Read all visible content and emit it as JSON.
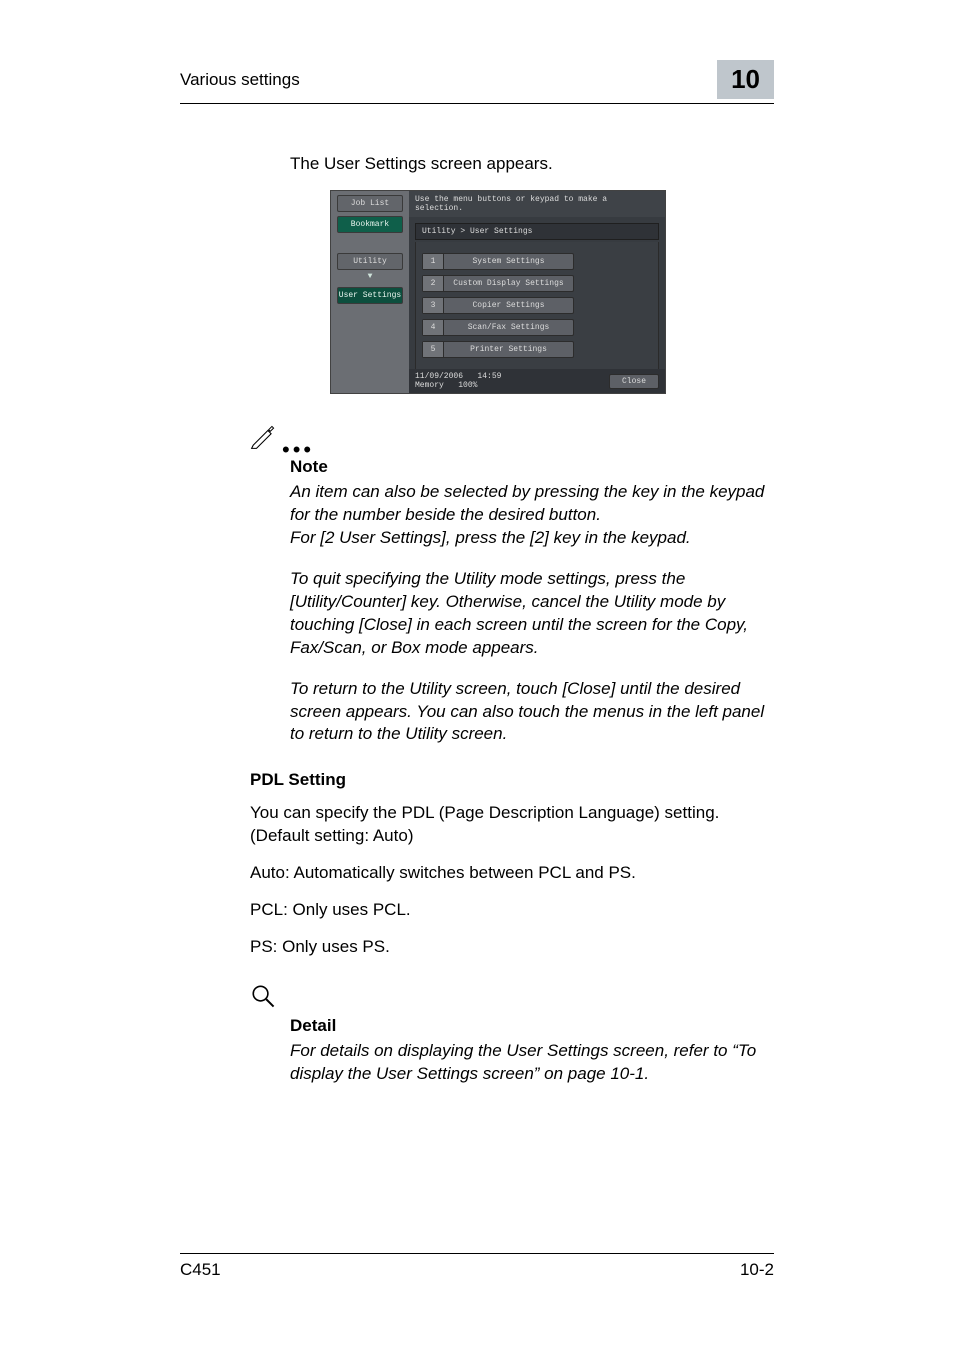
{
  "header": {
    "section": "Various settings",
    "chapter": "10"
  },
  "lead": "The User Settings screen appears.",
  "panel": {
    "hint": "Use the menu buttons or keypad to make a selection.",
    "breadcrumb": "Utility > User Settings",
    "tabs": {
      "joblist": "Job List",
      "bookmark": "Bookmark",
      "utility": "Utility",
      "usersettings": "User Settings"
    },
    "items": [
      {
        "n": "1",
        "label": "System Settings"
      },
      {
        "n": "2",
        "label": "Custom Display Settings"
      },
      {
        "n": "3",
        "label": "Copier Settings"
      },
      {
        "n": "4",
        "label": "Scan/Fax Settings"
      },
      {
        "n": "5",
        "label": "Printer Settings"
      }
    ],
    "status": {
      "date": "11/09/2006",
      "time": "14:59",
      "mem_lbl": "Memory",
      "mem_val": "100%",
      "close": "Close"
    }
  },
  "note": {
    "title": "Note",
    "p1": "An item can also be selected by pressing the key in the keypad for the number beside the desired button.",
    "p2": "For [2 User Settings], press the [2] key in the keypad.",
    "p3": "To quit specifying the Utility mode settings, press the [Utility/Counter] key. Otherwise, cancel the Utility mode by touching [Close] in each screen until the screen for the Copy, Fax/Scan, or Box mode appears.",
    "p4": "To return to the Utility screen, touch [Close] until the desired screen appears. You can also touch the menus in the left panel to return to the Utility screen."
  },
  "pdl": {
    "heading": "PDL Setting",
    "p1": "You can specify the PDL (Page Description Language) setting. (Default setting: Auto)",
    "p2": "Auto: Automatically switches between PCL and PS.",
    "p3": "PCL: Only uses PCL.",
    "p4": "PS: Only uses PS."
  },
  "detail": {
    "title": "Detail",
    "p1": "For details on displaying the User Settings screen, refer to “To display the User Settings screen” on page 10-1."
  },
  "footer": {
    "model": "C451",
    "page": "10-2"
  }
}
